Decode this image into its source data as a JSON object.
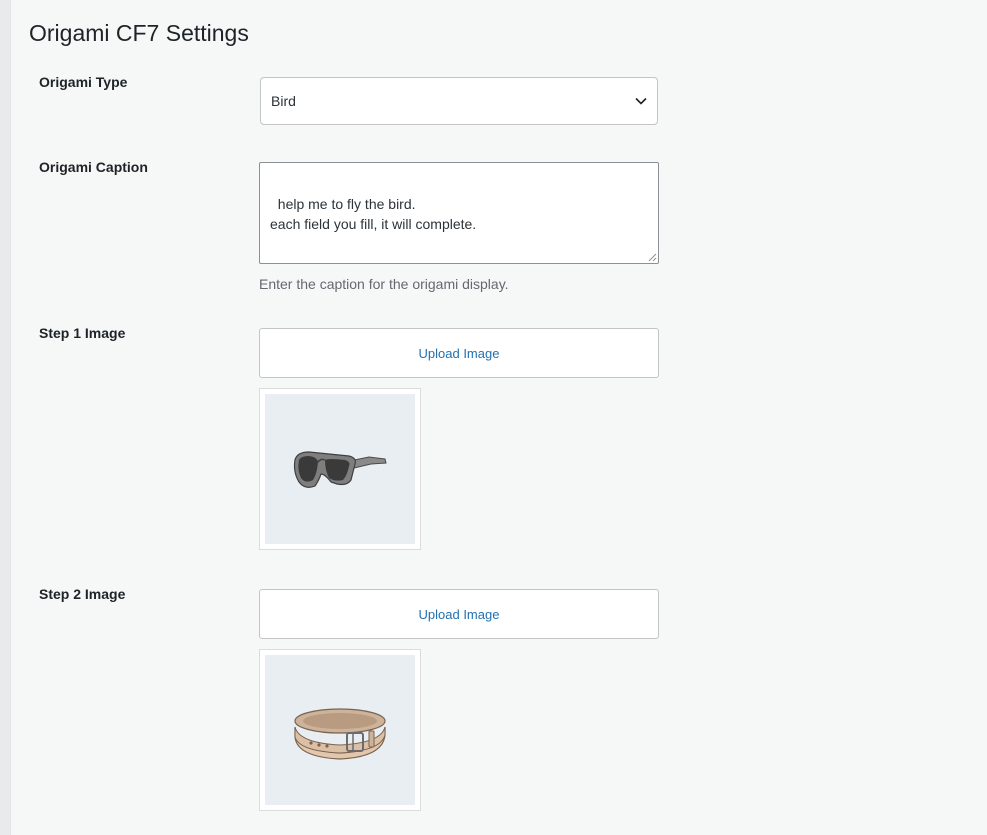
{
  "page": {
    "title": "Origami CF7 Settings"
  },
  "fields": {
    "origami_type": {
      "label": "Origami Type",
      "selected": "Bird"
    },
    "origami_caption": {
      "label": "Origami Caption",
      "value": "help me to fly the bird.\neach field you fill, it will complete.",
      "help": "Enter the caption for the origami display."
    },
    "step1": {
      "label": "Step 1 Image",
      "button": "Upload Image",
      "preview_icon": "sunglasses-image"
    },
    "step2": {
      "label": "Step 2 Image",
      "button": "Upload Image",
      "preview_icon": "belt-image"
    }
  },
  "colors": {
    "link": "#2271b1",
    "background": "#f6f7f7",
    "thumb_bg": "#e9eef3"
  }
}
